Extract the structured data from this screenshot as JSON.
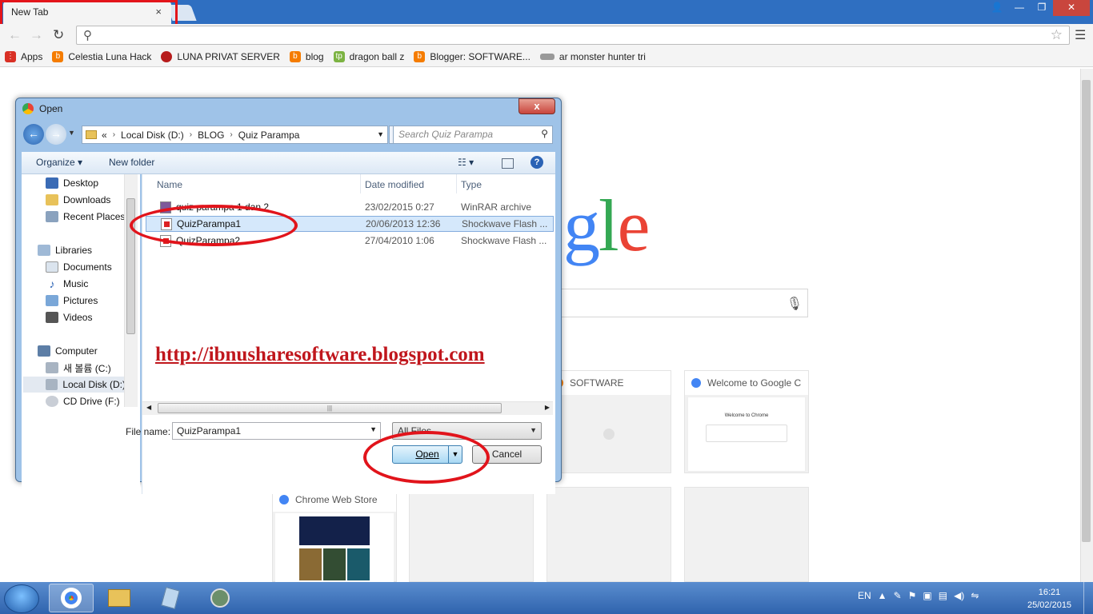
{
  "browser": {
    "tab_title": "New Tab",
    "tab_close": "×",
    "window_buttons": {
      "user": "👤",
      "minimize": "—",
      "restore": "❐",
      "close": "✕"
    },
    "omnibox_value": "",
    "bookmarks": [
      {
        "label": "Apps",
        "icon": "apps-grid-icon",
        "color": "#d93025"
      },
      {
        "label": "Celestia Luna Hack",
        "icon": "blogger-icon",
        "color": "#f57c00"
      },
      {
        "label": "LUNA PRIVAT SERVER",
        "icon": "luna-icon",
        "color": "#b71c1c"
      },
      {
        "label": "blog",
        "icon": "blogger-icon",
        "color": "#f57c00"
      },
      {
        "label": "dragon ball z",
        "icon": "tp-icon",
        "color": "#7cb342"
      },
      {
        "label": "Blogger: SOFTWARE...",
        "icon": "blogger-icon",
        "color": "#f57c00"
      },
      {
        "label": "ar monster hunter tri",
        "icon": "monster-icon",
        "color": "#777777"
      }
    ]
  },
  "newtab": {
    "logo_text": "gle",
    "tiles": [
      {
        "title": "SOFTWARE",
        "favicon_color": "#f57c00"
      },
      {
        "title": "Welcome to Google C",
        "favicon_color": "#4285f4"
      },
      {
        "title": "Chrome Web Store",
        "favicon_color": "#4285f4"
      },
      {
        "title": "",
        "favicon_color": ""
      },
      {
        "title": "",
        "favicon_color": ""
      },
      {
        "title": "",
        "favicon_color": ""
      }
    ],
    "welcome_preview_heading": "Welcome to Chrome"
  },
  "dialog": {
    "title": "Open",
    "close_label": "x",
    "address": {
      "prefix": "«",
      "segments": [
        "Local Disk (D:)",
        "BLOG",
        "Quiz Parampa"
      ]
    },
    "search_placeholder": "Search Quiz Parampa",
    "toolbar": {
      "organize": "Organize ▾",
      "new_folder": "New folder",
      "help": "?"
    },
    "nav": {
      "favorites": [
        "Desktop",
        "Downloads",
        "Recent Places"
      ],
      "libraries_label": "Libraries",
      "libraries": [
        "Documents",
        "Music",
        "Pictures",
        "Videos"
      ],
      "computer_label": "Computer",
      "drives": [
        "새 볼륨 (C:)",
        "Local Disk (D:)",
        "CD Drive (F:)"
      ]
    },
    "columns": [
      "Name",
      "Date modified",
      "Type"
    ],
    "files": [
      {
        "name": "quiz parampa 1 dan 2",
        "date": "23/02/2015 0:27",
        "type": "WinRAR archive",
        "selected": false
      },
      {
        "name": "QuizParampa1",
        "date": "20/06/2013 12:36",
        "type": "Shockwave Flash ...",
        "selected": true
      },
      {
        "name": "QuizParampa2",
        "date": "27/04/2010 1:06",
        "type": "Shockwave Flash ...",
        "selected": false
      }
    ],
    "file_name_label": "File name:",
    "file_name_value": "QuizParampa1",
    "filter_value": "All Files",
    "open_label": "Open",
    "cancel_label": "Cancel"
  },
  "watermark": "http://ibnusharesoftware.blogspot.com",
  "taskbar": {
    "lang": "EN",
    "time": "16:21",
    "date": "25/02/2015"
  },
  "annotation_color": "#e1141b"
}
